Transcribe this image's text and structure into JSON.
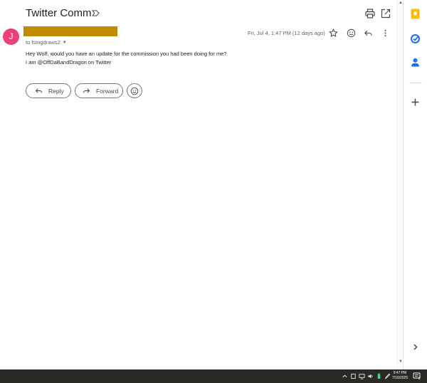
{
  "email": {
    "subject": "Twitter Comm",
    "avatar_letter": "J",
    "recipient": "to fstngdraws2",
    "date": "Fri, Jul 4, 1:47 PM (12 days ago)",
    "body": [
      "Hey Wolf, would you have an update for the commission you had been doing for me?",
      "I am @OffDaBandDragon on Twitter"
    ],
    "reply_label": "Reply",
    "forward_label": "Forward"
  },
  "taskbar": {
    "time": "9:47 PM",
    "date": "7/16/2025",
    "notification_count": "2"
  },
  "colors": {
    "avatar": "#ec407a",
    "redaction": "#bf8c00",
    "keep": "#fbbc04",
    "tasks": "#1a73e8",
    "contacts": "#1a73e8",
    "taskbar": "#2b2926"
  },
  "icons": {
    "label": "label-outline-icon",
    "print": "print-icon",
    "new_window": "open-in-new-window-icon",
    "star": "star-icon",
    "emoji": "emoji-icon",
    "reply": "reply-icon",
    "more": "more-vert-icon",
    "forward": "forward-icon",
    "keep": "keep-icon",
    "tasks": "tasks-icon",
    "contacts": "contacts-icon",
    "add": "add-icon",
    "expand": "chevron-right-icon"
  }
}
